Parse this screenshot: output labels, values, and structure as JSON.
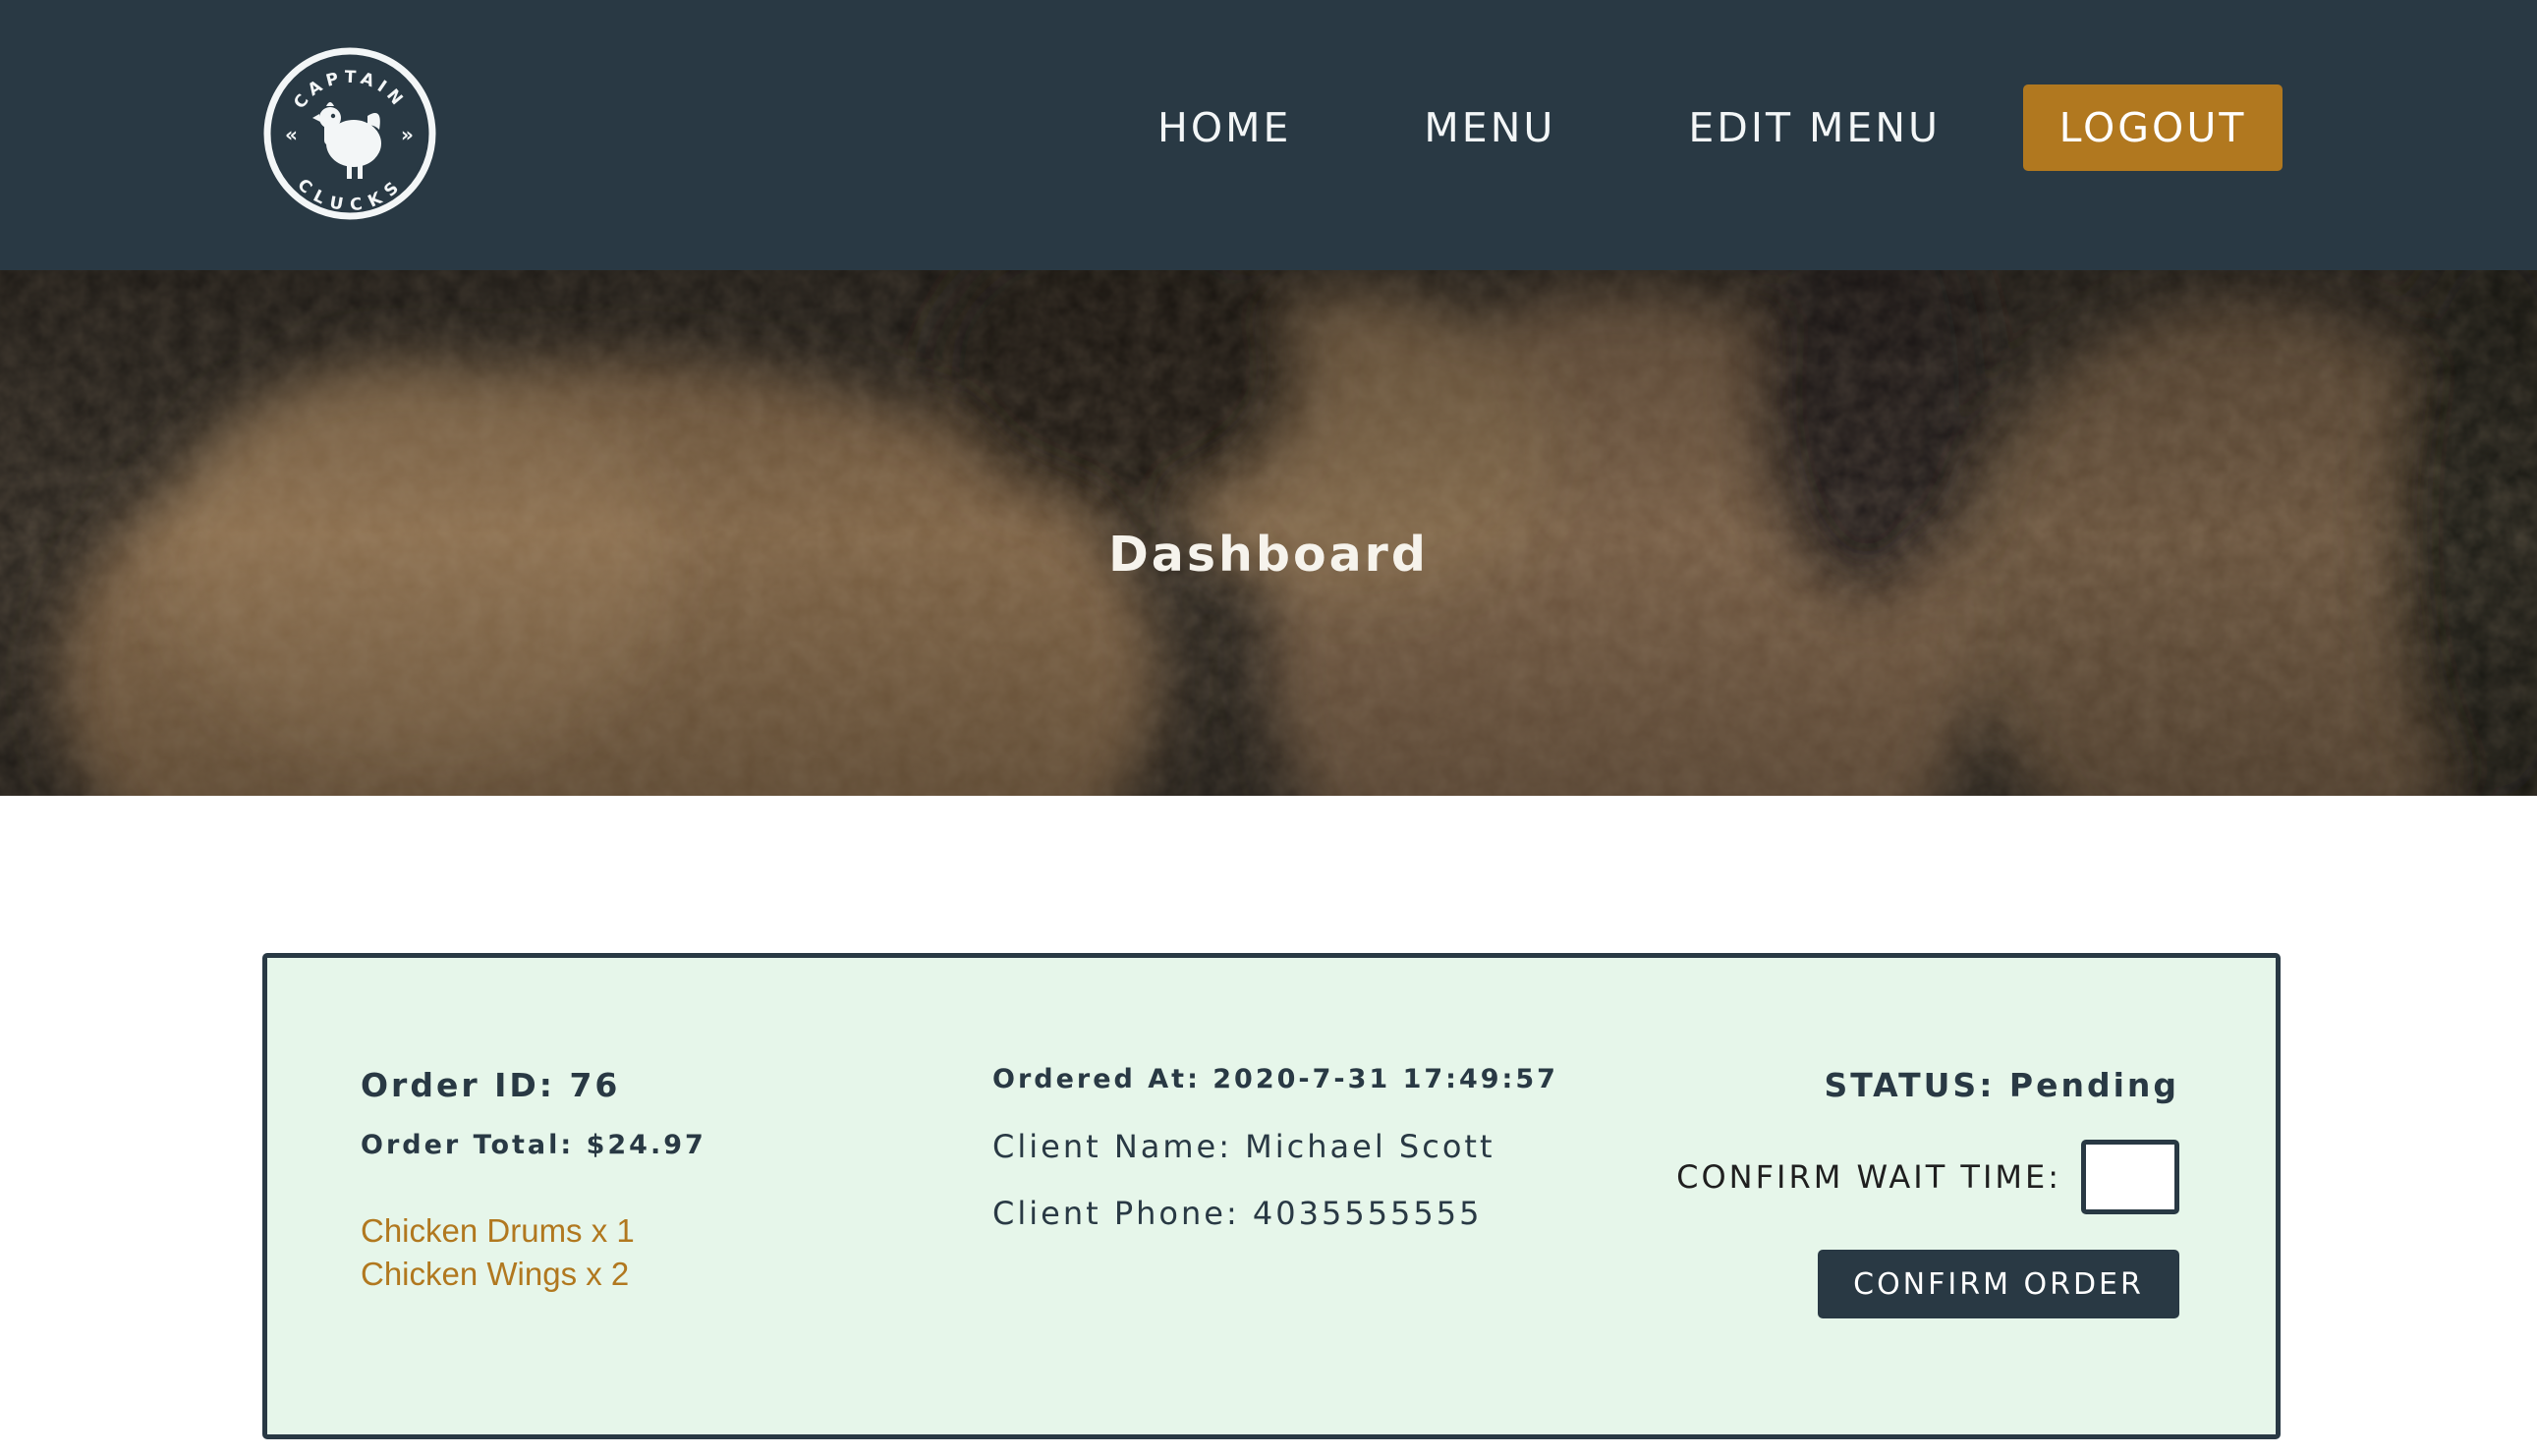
{
  "logo": {
    "text_top": "CAPTAIN",
    "text_bottom": "CLUCKS"
  },
  "nav": {
    "items": [
      {
        "label": "HOME"
      },
      {
        "label": "MENU"
      },
      {
        "label": "EDIT MENU"
      }
    ],
    "logout_label": "LOGOUT"
  },
  "hero": {
    "title": "Dashboard"
  },
  "order": {
    "id_text": "Order ID: 76",
    "total_text": "Order Total: $24.97",
    "items": [
      {
        "label": "Chicken Drums x 1"
      },
      {
        "label": "Chicken Wings x 2"
      }
    ],
    "ordered_at_text": "Ordered At: 2020-7-31 17:49:57",
    "client_name_text": "Client Name: Michael Scott",
    "client_phone_text": "Client Phone: 4035555555",
    "status_text": "STATUS: Pending",
    "wait_time_label": "CONFIRM WAIT TIME:",
    "wait_time_value": "",
    "confirm_label": "CONFIRM ORDER"
  },
  "colors": {
    "header_bg": "#293944",
    "accent": "#b1781f",
    "card_bg": "#e6f6ea"
  }
}
